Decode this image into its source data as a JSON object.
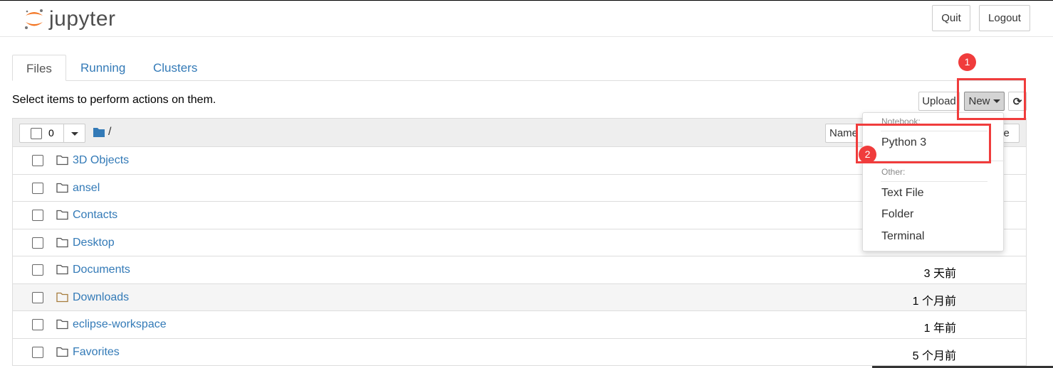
{
  "header": {
    "logo_text": "jupyter",
    "quit": "Quit",
    "logout": "Logout"
  },
  "tabs": [
    {
      "label": "Files"
    },
    {
      "label": "Running"
    },
    {
      "label": "Clusters"
    }
  ],
  "toolbar": {
    "hint": "Select items to perform actions on them.",
    "upload": "Upload",
    "new": "New",
    "selected_count": "0",
    "path": "/",
    "sort_name": "Name",
    "sort_size": "ze"
  },
  "files": [
    {
      "name": "3D Objects",
      "time": ""
    },
    {
      "name": "ansel",
      "time": ""
    },
    {
      "name": "Contacts",
      "time": ""
    },
    {
      "name": "Desktop",
      "time": ""
    },
    {
      "name": "Documents",
      "time": "3 天前"
    },
    {
      "name": "Downloads",
      "time": "1 个月前"
    },
    {
      "name": "eclipse-workspace",
      "time": "1 年前"
    },
    {
      "name": "Favorites",
      "time": "5 个月前"
    }
  ],
  "new_menu": {
    "notebook_header": "Notebook:",
    "python3": "Python 3",
    "other_header": "Other:",
    "text_file": "Text File",
    "folder": "Folder",
    "terminal": "Terminal"
  },
  "annotations": [
    "1",
    "2"
  ],
  "colors": {
    "link": "#337ab7",
    "annotation": "#f03c3c",
    "logo_orange": "#f37726"
  }
}
